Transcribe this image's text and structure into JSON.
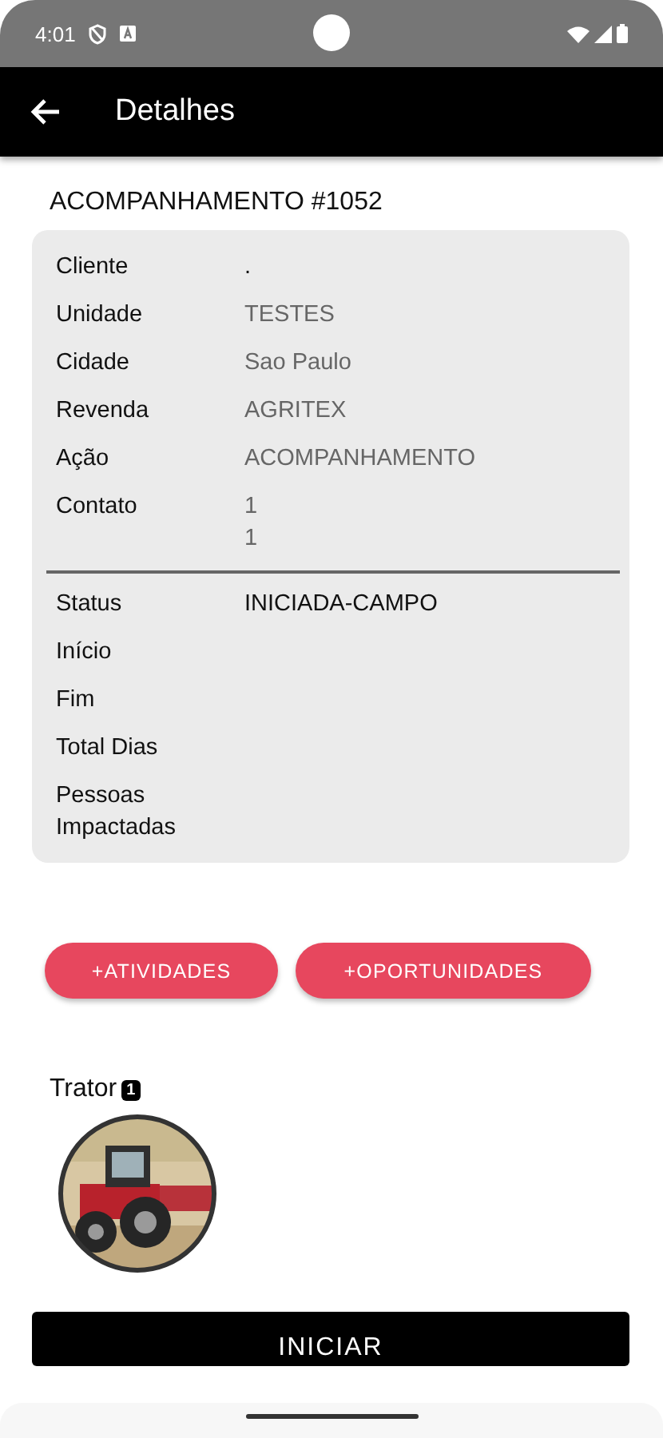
{
  "status_bar": {
    "time": "4:01"
  },
  "app_bar": {
    "title": "Detalhes"
  },
  "heading": "ACOMPANHAMENTO #1052",
  "details": {
    "sections": [
      {
        "rows": [
          {
            "label": "Cliente",
            "values": [
              "."
            ],
            "kind": "strong"
          },
          {
            "label": "Unidade",
            "values": [
              "TESTES"
            ],
            "kind": "plain"
          },
          {
            "label": "Cidade",
            "values": [
              "Sao Paulo"
            ],
            "kind": "plain"
          },
          {
            "label": "Revenda",
            "values": [
              "AGRITEX"
            ],
            "kind": "plain"
          },
          {
            "label": "Ação",
            "values": [
              "ACOMPANHAMENTO"
            ],
            "kind": "plain"
          },
          {
            "label": "Contato",
            "values": [
              "1",
              "1"
            ],
            "kind": "plain"
          }
        ]
      },
      {
        "rows": [
          {
            "label": "Status",
            "values": [
              "INICIADA-CAMPO"
            ],
            "kind": "strong"
          },
          {
            "label": "Início"
          },
          {
            "label": "Fim"
          },
          {
            "label": "Total Dias"
          },
          {
            "label": "Pessoas Impactadas"
          }
        ]
      }
    ]
  },
  "actions": [
    "+ATIVIDADES",
    "+OPORTUNIDADES"
  ],
  "equipment": {
    "label": "Trator",
    "count": "1"
  },
  "primary_button": "INICIAR"
}
